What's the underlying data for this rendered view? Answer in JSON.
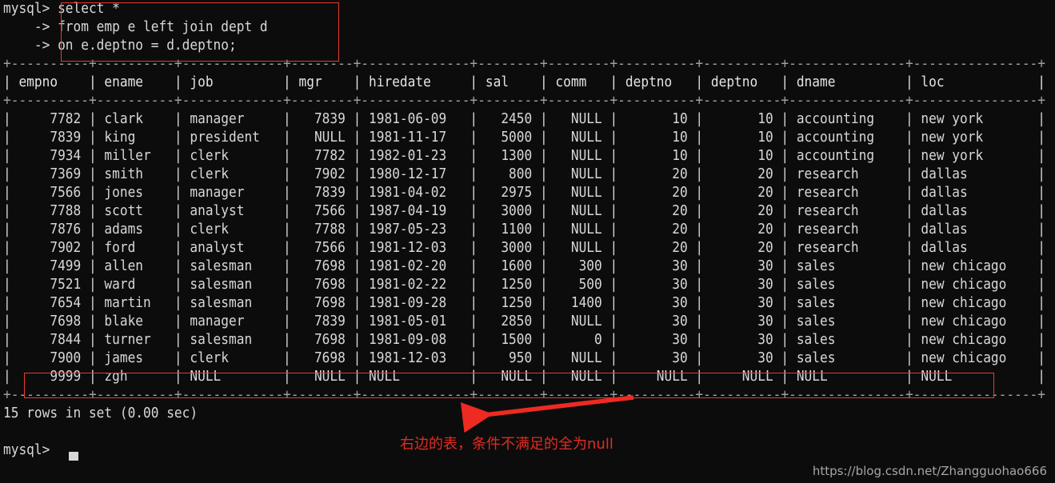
{
  "terminal": {
    "prompt": "mysql>",
    "continuation": "    ->",
    "query_lines": [
      "select *",
      "from emp e left join dept d",
      "on e.deptno = d.deptno;"
    ],
    "final_prompt": "mysql>",
    "status_line": "15 rows in set (0.00 sec)",
    "columns": [
      {
        "name": "empno",
        "width": 8,
        "align": "right"
      },
      {
        "name": "ename",
        "width": 8,
        "align": "left"
      },
      {
        "name": "job",
        "width": 11,
        "align": "left"
      },
      {
        "name": "mgr",
        "width": 6,
        "align": "right"
      },
      {
        "name": "hiredate",
        "width": 12,
        "align": "left"
      },
      {
        "name": "sal",
        "width": 6,
        "align": "right"
      },
      {
        "name": "comm",
        "width": 6,
        "align": "right"
      },
      {
        "name": "deptno",
        "width": 8,
        "align": "right"
      },
      {
        "name": "deptno",
        "width": 8,
        "align": "right"
      },
      {
        "name": "dname",
        "width": 13,
        "align": "left"
      },
      {
        "name": "loc",
        "width": 14,
        "align": "left"
      }
    ],
    "rows": [
      [
        "7782",
        "clark",
        "manager",
        "7839",
        "1981-06-09",
        "2450",
        "NULL",
        "10",
        "10",
        "accounting",
        "new york"
      ],
      [
        "7839",
        "king",
        "president",
        "NULL",
        "1981-11-17",
        "5000",
        "NULL",
        "10",
        "10",
        "accounting",
        "new york"
      ],
      [
        "7934",
        "miller",
        "clerk",
        "7782",
        "1982-01-23",
        "1300",
        "NULL",
        "10",
        "10",
        "accounting",
        "new york"
      ],
      [
        "7369",
        "smith",
        "clerk",
        "7902",
        "1980-12-17",
        "800",
        "NULL",
        "20",
        "20",
        "research",
        "dallas"
      ],
      [
        "7566",
        "jones",
        "manager",
        "7839",
        "1981-04-02",
        "2975",
        "NULL",
        "20",
        "20",
        "research",
        "dallas"
      ],
      [
        "7788",
        "scott",
        "analyst",
        "7566",
        "1987-04-19",
        "3000",
        "NULL",
        "20",
        "20",
        "research",
        "dallas"
      ],
      [
        "7876",
        "adams",
        "clerk",
        "7788",
        "1987-05-23",
        "1100",
        "NULL",
        "20",
        "20",
        "research",
        "dallas"
      ],
      [
        "7902",
        "ford",
        "analyst",
        "7566",
        "1981-12-03",
        "3000",
        "NULL",
        "20",
        "20",
        "research",
        "dallas"
      ],
      [
        "7499",
        "allen",
        "salesman",
        "7698",
        "1981-02-20",
        "1600",
        "300",
        "30",
        "30",
        "sales",
        "new chicago"
      ],
      [
        "7521",
        "ward",
        "salesman",
        "7698",
        "1981-02-22",
        "1250",
        "500",
        "30",
        "30",
        "sales",
        "new chicago"
      ],
      [
        "7654",
        "martin",
        "salesman",
        "7698",
        "1981-09-28",
        "1250",
        "1400",
        "30",
        "30",
        "sales",
        "new chicago"
      ],
      [
        "7698",
        "blake",
        "manager",
        "7839",
        "1981-05-01",
        "2850",
        "NULL",
        "30",
        "30",
        "sales",
        "new chicago"
      ],
      [
        "7844",
        "turner",
        "salesman",
        "7698",
        "1981-09-08",
        "1500",
        "0",
        "30",
        "30",
        "sales",
        "new chicago"
      ],
      [
        "7900",
        "james",
        "clerk",
        "7698",
        "1981-12-03",
        "950",
        "NULL",
        "30",
        "30",
        "sales",
        "new chicago"
      ],
      [
        "9999",
        "zgh",
        "NULL",
        "NULL",
        "NULL",
        "NULL",
        "NULL",
        "NULL",
        "NULL",
        "NULL",
        "NULL"
      ]
    ]
  },
  "annotations": {
    "note_text": "右边的表，条件不满足的全为null",
    "note_color": "#e12c22",
    "box_color": "#e83b30",
    "arrow_color": "#ee2a22"
  },
  "watermark": {
    "text": "https://blog.csdn.net/Zhangguohao666"
  }
}
